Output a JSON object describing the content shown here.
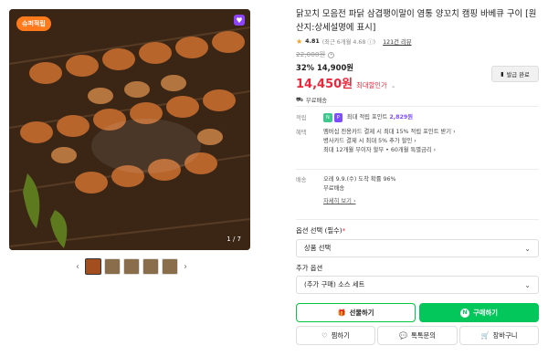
{
  "gallery": {
    "badge": "슈퍼적립",
    "counter": "1 / 7",
    "thumb_count": 5
  },
  "product": {
    "title": "닭꼬치 모음전 파닭 삼겹팽이말이 염통 양꼬치 캠핑 바베큐 구이 [원산지:상세설명에 표시]",
    "rating_score": "4.81",
    "rating_detail": "(최근 6개월 4.68 ⓘ)",
    "review_link": "121건 리뷰",
    "original_price": "22,000원",
    "discount": "32% 14,900원",
    "max_discount_price": "14,450원",
    "max_discount_label": "최대할인가",
    "shipping_note": "무료배송",
    "coupon_button": "발급 완료"
  },
  "benefit": {
    "point_label": "적립",
    "point_text": "최대 적립 포인트",
    "point_value": "2,829원",
    "card_label": "혜택",
    "card_lines": [
      "멤버십 전용카드 결제 시 최대 15% 적립 포인트 받기 ›",
      "병사카드 결제 시 최대 5% 추가 할인 ›",
      "최대 12개월 무이자 할부 • 60개월 특별금리 ›"
    ]
  },
  "delivery": {
    "label": "배송",
    "line1": "오레 9.9.(수) 도착 확률 96%",
    "line2": "무료배송",
    "detail_button": "자세히 보기 ›"
  },
  "options": {
    "option_label": "옵션 선택 (필수)",
    "option_required_mark": "*",
    "option_value": "상품 선택",
    "extra_label": "추가 옵션",
    "extra_value": "(추가 구매) 소스 세트"
  },
  "actions": {
    "gift": "선물하기",
    "buy": "구매하기",
    "wish": "찜하기",
    "talk": "톡톡문의",
    "cart": "장바구니"
  },
  "colors": {
    "price_red": "#e8283b",
    "buy_green": "#03c75a",
    "point_purple": "#7b4dff"
  }
}
